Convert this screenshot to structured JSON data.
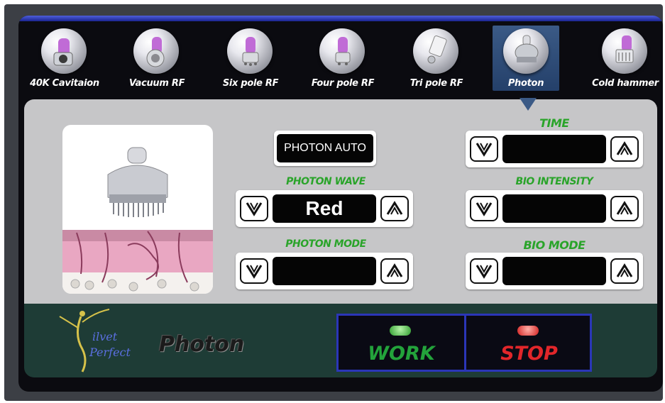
{
  "tools": [
    {
      "label": "40K Cavitaion",
      "icon": "cavitation-head-icon"
    },
    {
      "label": "Vacuum RF",
      "icon": "vacuum-rf-head-icon"
    },
    {
      "label": "Six pole RF",
      "icon": "six-pole-rf-head-icon"
    },
    {
      "label": "Four pole RF",
      "icon": "four-pole-rf-head-icon"
    },
    {
      "label": "Tri pole RF",
      "icon": "tri-pole-rf-head-icon"
    },
    {
      "label": "Photon",
      "icon": "photon-head-icon",
      "selected": true
    },
    {
      "label": "Cold hammer",
      "icon": "cold-hammer-head-icon"
    }
  ],
  "controls": {
    "auto_label": "PHOTON AUTO",
    "photon_wave": {
      "label": "PHOTON WAVE",
      "value": "Red"
    },
    "photon_mode": {
      "label": "PHOTON MODE",
      "value": ""
    },
    "time": {
      "label": "TIME",
      "value": ""
    },
    "bio_intensity": {
      "label": "BIO INTENSITY",
      "value": ""
    },
    "bio_mode": {
      "label": "BIO MODE",
      "value": ""
    }
  },
  "footer": {
    "logo_text_1": "ilvet",
    "logo_text_2": "Perfect",
    "mode_name": "Photon",
    "work_label": "WORK",
    "stop_label": "STOP"
  },
  "colors": {
    "header_green": "#2aa42a",
    "work_green": "#23a33b",
    "stop_red": "#e2262a",
    "frame_blue": "#2b36b8",
    "selected_tab": "#3b5a86"
  }
}
